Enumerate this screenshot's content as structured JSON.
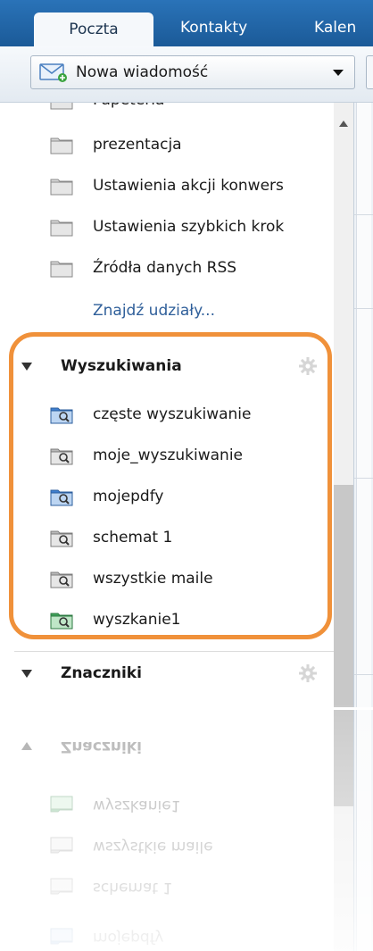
{
  "tabs": [
    {
      "label": "Poczta",
      "active": true
    },
    {
      "label": "Kontakty",
      "active": false
    },
    {
      "label": "Kalen",
      "active": false
    }
  ],
  "toolbar": {
    "new_message_label": "Nowa wiadomość"
  },
  "folders": [
    {
      "label": "Papeteria",
      "icon": "folder-icon"
    },
    {
      "label": "prezentacja",
      "icon": "folder-icon"
    },
    {
      "label": "Ustawienia akcji konwers",
      "icon": "folder-icon"
    },
    {
      "label": "Ustawienia szybkich krok",
      "icon": "folder-icon"
    },
    {
      "label": "Źródła danych RSS",
      "icon": "folder-icon"
    }
  ],
  "find_shares_link": "Znajdź udziały...",
  "searches_section": {
    "title": "Wyszukiwania",
    "items": [
      {
        "label": "częste wyszukiwanie",
        "color": "#3f7fd0"
      },
      {
        "label": "moje_wyszukiwanie",
        "color": "#9a9a9a"
      },
      {
        "label": "mojepdfy",
        "color": "#3f7fd0"
      },
      {
        "label": "schemat 1",
        "color": "#9a9a9a"
      },
      {
        "label": "wszystkie maile",
        "color": "#9a9a9a"
      },
      {
        "label": "wyszkanie1",
        "color": "#3fa25a"
      }
    ]
  },
  "tags_section": {
    "title": "Znaczniki"
  },
  "colors": {
    "tabbar": "#1f64a8",
    "highlight": "#f0913a",
    "link": "#2f5f9a"
  }
}
